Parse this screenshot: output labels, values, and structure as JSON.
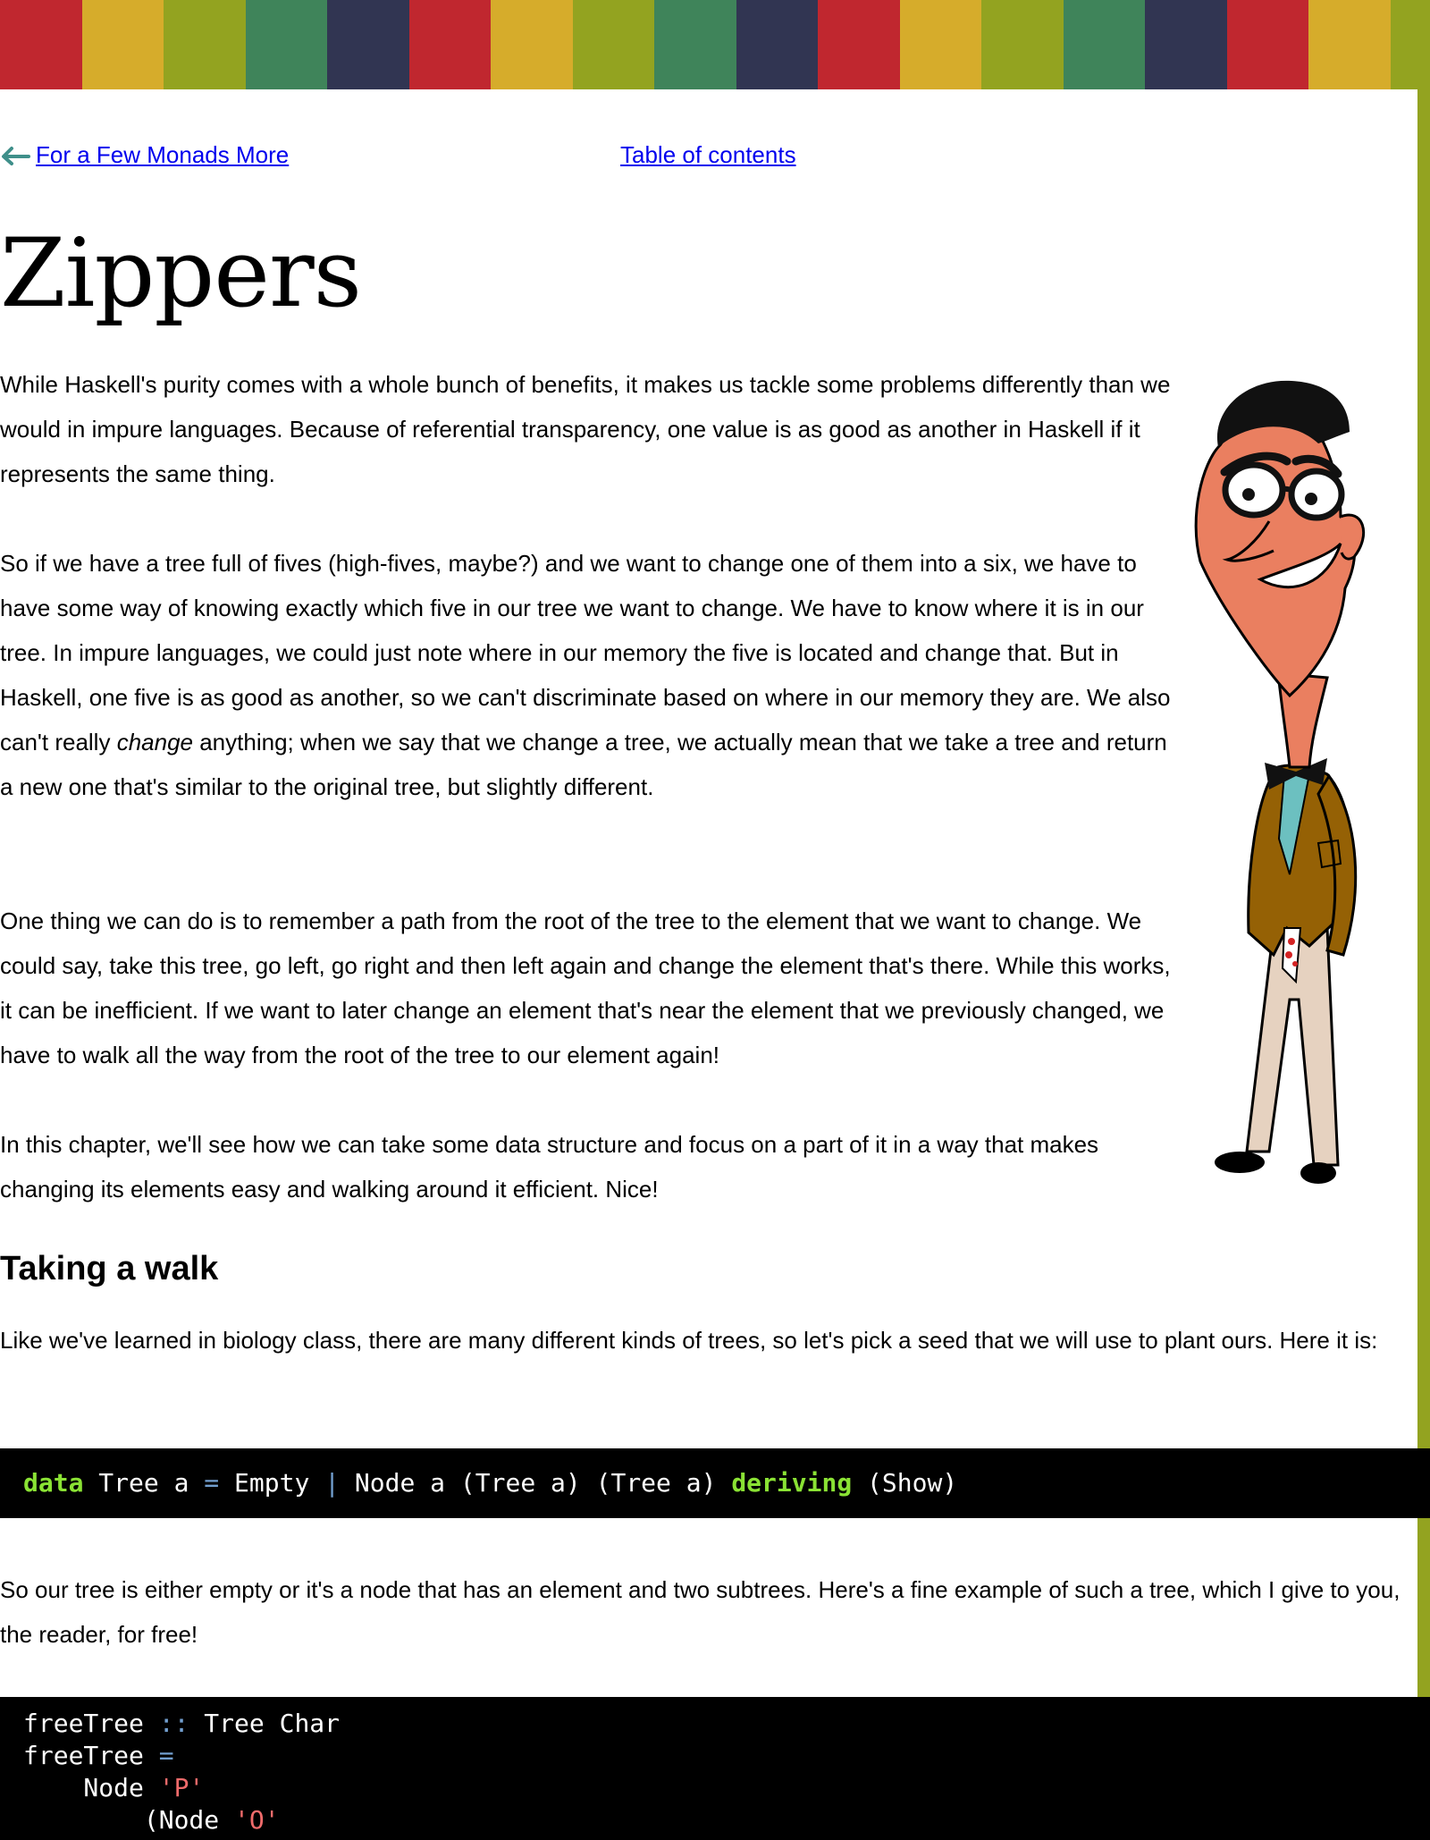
{
  "top_stripe": {
    "colors": [
      "#c0272f",
      "#d6ac2b",
      "#93a320",
      "#3f845a",
      "#313552",
      "#c0272f",
      "#d6ac2b",
      "#93a320",
      "#3f845a",
      "#313552",
      "#c0272f",
      "#d6ac2b",
      "#93a320",
      "#3f845a",
      "#313552",
      "#c0272f",
      "#d6ac2b",
      "#93a320"
    ]
  },
  "nav": {
    "prev_icon": "left-arrow-icon",
    "prev_label": "For a Few Monads More",
    "toc_label": "Table of contents"
  },
  "title": "Zippers",
  "intro": {
    "p1": "While Haskell's purity comes with a whole bunch of benefits, it makes us tackle some problems differently than we would in impure languages. Because of referential transparency, one value is as good as another in Haskell if it represents the same thing.",
    "p2_before": "So if we have a tree full of fives (high-fives, maybe?) and we want to change one of them into a six, we have to have some way of knowing exactly which five in our tree we want to change. We have to know where it is in our tree. In impure languages, we could just note where in our memory the five is located and change that. But in Haskell, one five is as good as another, so we can't discriminate based on where in our memory they are. We also can't really ",
    "p2_em": "change",
    "p2_after": " anything; when we say that we change a tree, we actually mean that we take a tree and return a new one that's similar to the original tree, but slightly different.",
    "p3": "One thing we can do is to remember a path from the root of the tree to the element that we want to change. We could say, take this tree, go left, go right and then left again and change the element that's there. While this works, it can be inefficient. If we want to later change an element that's near the element that we previously changed, we have to walk all the way from the root of the tree to our element again!",
    "p4": "In this chapter, we'll see how we can take some data structure and focus on a part of it in a way that makes changing its elements easy and walking around it efficient. Nice!"
  },
  "section": {
    "heading": "Taking a walk",
    "p1": "Like we've learned in biology class, there are many different kinds of trees, so let's pick a seed that we will use to plant ours. Here it is:",
    "p2": "So our tree is either empty or it's a node that has an element and two subtrees. Here's a fine example of such a tree, which I give to you, the reader, for free!"
  },
  "code1": {
    "kw_data": "data",
    "a": " Tree a ",
    "eq": "=",
    "b": " Empty ",
    "bar": "|",
    "c": " Node a (Tree a) (Tree a) ",
    "kw_deriving": "deriving",
    "d": " (Show)"
  },
  "code2": {
    "l1_name": "freeTree ",
    "l1_op": "::",
    "l1_type": " Tree Char",
    "l2_name": "freeTree ",
    "l2_op": "=",
    "l3_pre": "    Node ",
    "l3_str": "'P'",
    "l4_pre": "        (Node ",
    "l4_str": "'O'"
  },
  "figure": {
    "icon": "cartoon-man-with-glasses-illustration"
  }
}
